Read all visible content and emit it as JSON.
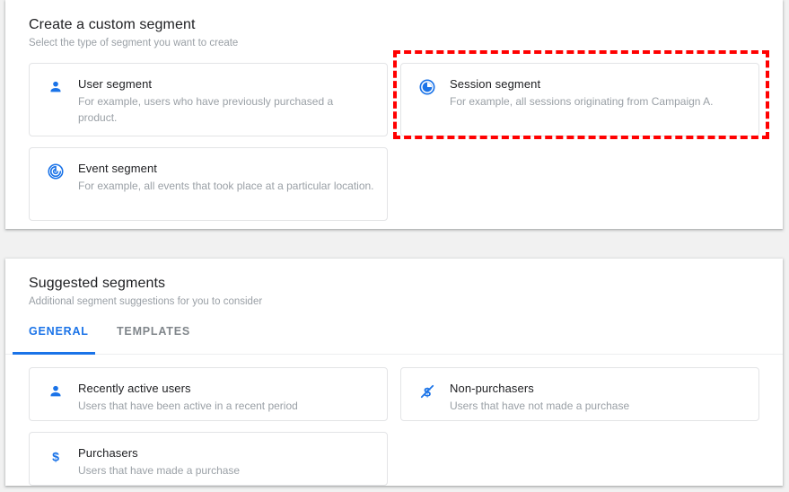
{
  "custom_section": {
    "title": "Create a custom segment",
    "subtitle": "Select the type of segment you want to create",
    "cards": [
      {
        "id": "user-segment",
        "icon": "person-icon",
        "title": "User segment",
        "description": "For example, users who have previously purchased a product."
      },
      {
        "id": "session-segment",
        "icon": "session-clock-icon",
        "title": "Session segment",
        "description": "For example, all sessions originating from Campaign A."
      },
      {
        "id": "event-segment",
        "icon": "event-swirl-icon",
        "title": "Event segment",
        "description": "For example, all events that took place at a particular location."
      }
    ]
  },
  "suggested_section": {
    "title": "Suggested segments",
    "subtitle": "Additional segment suggestions for you to consider",
    "tabs": [
      {
        "id": "general",
        "label": "GENERAL",
        "active": true
      },
      {
        "id": "templates",
        "label": "TEMPLATES",
        "active": false
      }
    ],
    "cards": [
      {
        "id": "recently-active-users",
        "icon": "person-icon",
        "title": "Recently active users",
        "description": "Users that have been active in a recent period"
      },
      {
        "id": "non-purchasers",
        "icon": "dollar-slash-icon",
        "title": "Non-purchasers",
        "description": "Users that have not made a purchase"
      },
      {
        "id": "purchasers",
        "icon": "dollar-icon",
        "title": "Purchasers",
        "description": "Users that have made a purchase"
      }
    ]
  },
  "annotation": {
    "highlight_target": "session-segment",
    "color": "#ff0000",
    "style": "dashed"
  },
  "colors": {
    "accent": "#1a73e8",
    "text_primary": "#202124",
    "text_secondary": "#9aa0a6",
    "page_background": "#f1f1f1",
    "card_border": "#e3e4e6"
  }
}
